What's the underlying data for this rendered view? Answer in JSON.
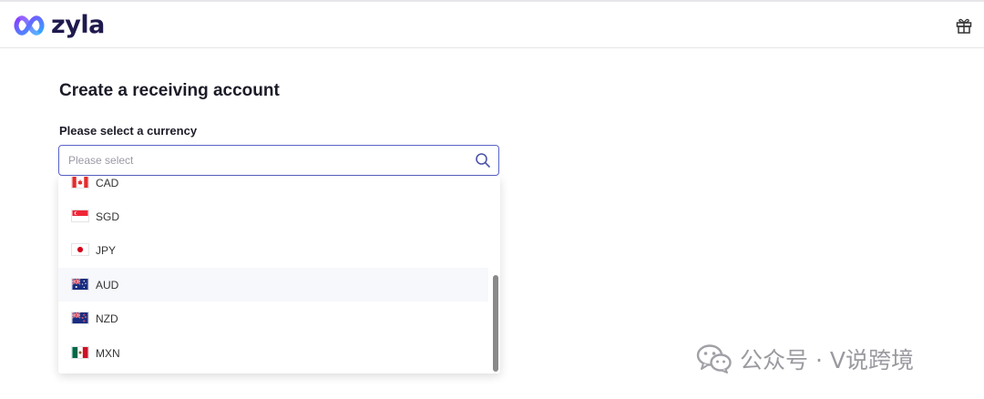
{
  "brand": {
    "name": "zyla",
    "logo_colors": [
      "#7b4dff",
      "#3aa0ff"
    ]
  },
  "header": {
    "gift_icon": "gift-icon"
  },
  "page": {
    "title": "Create a receiving account"
  },
  "currency_field": {
    "label": "Please select a currency",
    "placeholder": "Please select",
    "value": "",
    "icon": "search-icon"
  },
  "dropdown": {
    "options": [
      {
        "code": "CAD",
        "flag": "canada-flag-icon"
      },
      {
        "code": "SGD",
        "flag": "singapore-flag-icon"
      },
      {
        "code": "JPY",
        "flag": "japan-flag-icon"
      },
      {
        "code": "AUD",
        "flag": "australia-flag-icon",
        "hovered": true
      },
      {
        "code": "NZD",
        "flag": "new-zealand-flag-icon"
      },
      {
        "code": "MXN",
        "flag": "mexico-flag-icon"
      }
    ]
  },
  "watermark": {
    "text": "公众号 · V说跨境"
  },
  "colors": {
    "accent": "#5a63c8",
    "title_text": "#1c1c28",
    "hover_bg": "#f7f8fb"
  }
}
